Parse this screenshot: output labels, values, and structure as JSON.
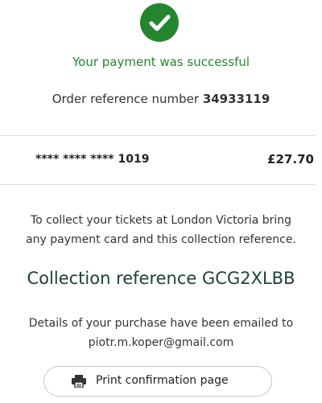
{
  "payment": {
    "success_message": "Your payment was successful",
    "order_ref_label": "Order reference number",
    "order_ref_number": "34933119",
    "card_mask": "**** **** **** 1019",
    "amount": "£27.70"
  },
  "collection": {
    "instructions_line1": "To collect your tickets at London Victoria bring",
    "instructions_line2": "any payment card and this collection reference.",
    "reference_line": "Collection reference GCG2XLBB"
  },
  "email": {
    "details_line1": "Details of your purchase have been emailed to",
    "address": "piotr.m.koper@gmail.com"
  },
  "actions": {
    "print_label": "Print confirmation page"
  },
  "colors": {
    "success_green": "#23862e",
    "reference_dark_green": "#1c4236"
  },
  "icons": {
    "success": "check-circle-icon",
    "print": "printer-icon"
  }
}
